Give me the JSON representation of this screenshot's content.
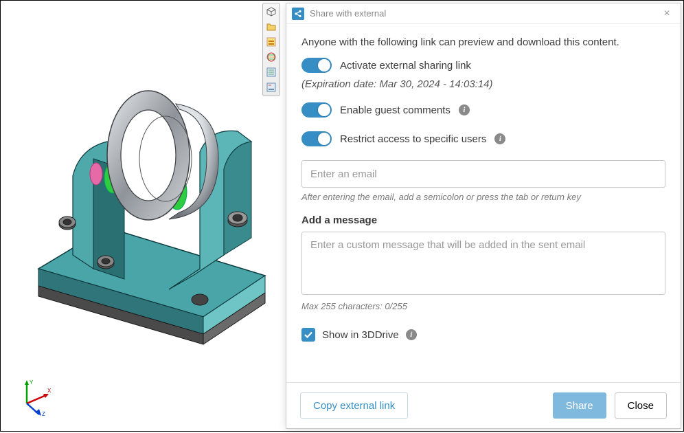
{
  "dialog": {
    "title": "Share with external",
    "intro": "Anyone with the following link can preview and download this content.",
    "activate_label": "Activate external sharing link",
    "activate_on": true,
    "expiration_prefix": "(Expiration date: ",
    "expiration_value": "Mar 30, 2024 - 14:03:14",
    "expiration_suffix": ")",
    "guest_comments_label": "Enable guest comments",
    "guest_comments_on": true,
    "restrict_label": "Restrict access to specific users",
    "restrict_on": true,
    "email_placeholder": "Enter an email",
    "email_hint": "After entering the email, add a semicolon or press the tab or return key",
    "message_section": "Add a message",
    "message_placeholder": "Enter a custom message that will be added in the sent email",
    "char_counter": "Max 255 characters: 0/255",
    "show_in_drive_label": "Show in 3DDrive",
    "show_in_drive_checked": true,
    "copy_link_label": "Copy external link",
    "share_label": "Share",
    "close_label": "Close"
  },
  "toolstrip": {
    "items": [
      "cube",
      "folder",
      "panel",
      "globe",
      "properties",
      "settings"
    ]
  },
  "triad": {
    "x_label": "X",
    "y_label": "Y",
    "z_label": "Z"
  }
}
